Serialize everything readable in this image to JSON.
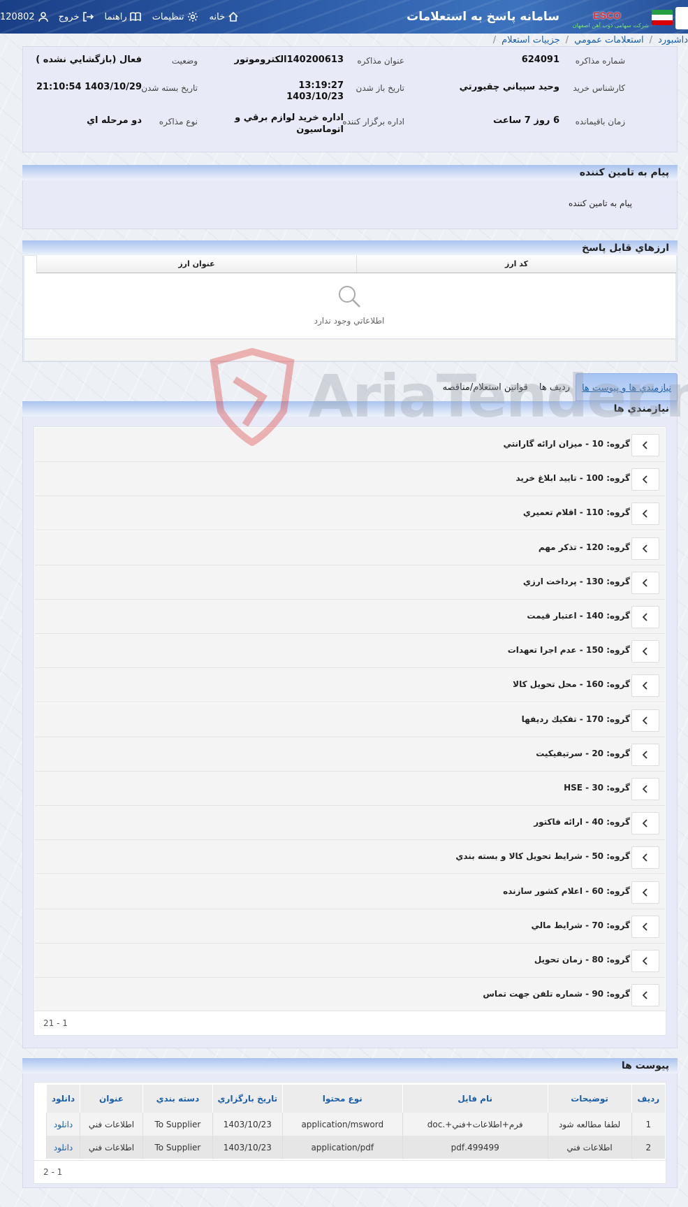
{
  "header": {
    "title": "سامانه پاسخ به استعلامات",
    "logo_text": "ESCO",
    "logo_subtitle": "شرکت سهامی ذوب آهن اصفهان",
    "user_id": "120802",
    "nav": [
      {
        "label": "خروج",
        "icon": "logout-icon"
      },
      {
        "label": "راهنما",
        "icon": "book-icon"
      },
      {
        "label": "تنظيمات",
        "icon": "gear-icon"
      },
      {
        "label": "خانه",
        "icon": "home-icon"
      }
    ]
  },
  "breadcrumb": [
    "داشبورد",
    "استعلامات عمومي",
    "جزييات استعلام"
  ],
  "info": {
    "negotiation_number_label": "شماره مذاکره",
    "negotiation_number": "624091",
    "title_label": "عنوان مذاکره",
    "title": "140200613الكتروموتور",
    "status_label": "وضعيت",
    "status": "فعال (بازگشايي نشده )",
    "buyer_label": "کارشناس خريد",
    "buyer": "وحيد سپياني چقيورتي",
    "open_date_label": "تاريخ باز شدن",
    "open_time": "13:19:27",
    "open_date": "1403/10/23",
    "close_date_label": "تاريخ بسته شدن",
    "close_date": "1403/10/29 21:10:54",
    "remaining_label": "زمان باقيمانده",
    "remaining": "6 روز 7 ساعت",
    "organizer_label": "اداره برگزار کننده",
    "organizer_line1": "اداره خريد لوازم برقي و",
    "organizer_line2": "اتوماسيون",
    "type_label": "نوع مذاکره",
    "type": "دو مرحله اي"
  },
  "supplier_message": {
    "heading": "پيام به تامين کننده",
    "body": "پيام به تامين کننده"
  },
  "currencies": {
    "heading": "ارزهاي قابل پاسخ",
    "col_code": "کد ارز",
    "col_title": "عنوان ارز",
    "empty_text": "اطلاعاتي وجود ندارد"
  },
  "tabs": [
    {
      "label": "نيازمندي ها و پيوست ها",
      "active": true
    },
    {
      "label": "رديف ها",
      "active": false
    },
    {
      "label": "قوانين استعلام/مناقصه",
      "active": false
    }
  ],
  "requirements": {
    "heading": "نيازمندي ها",
    "groups": [
      "گروه: 10 - ميزان ارائه گارانتي",
      "گروه: 100 - تاييد ابلاغ خريد",
      "گروه: 110 - اقلام تعميري",
      "گروه: 120 - تذکر مهم",
      "گروه: 130 - پرداخت ارزي",
      "گروه: 140 - اعتبار قيمت",
      "گروه: 150 - عدم اجرا تعهدات",
      "گروه: 160 - محل تحويل کالا",
      "گروه: 170 - تفکيك رديفها",
      "گروه: 20 - سرتيفيکيت",
      "گروه: 30 - HSE",
      "گروه: 40 - ارائه فاکتور",
      "گروه: 50 - شرايط تحويل کالا و بسته بندي",
      "گروه: 60 - اعلام کشور سازنده",
      "گروه: 70 - شرايط مالي",
      "گروه: 80 - زمان تحويل",
      "گروه: 90 - شماره تلفن جهت تماس"
    ],
    "pager": "21 - 1"
  },
  "attachments": {
    "heading": "پيوست ها",
    "columns": [
      "رديف",
      "توضيحات",
      "نام فايل",
      "نوع محتوا",
      "تاريخ بارگزاري",
      "دسته بندي",
      "عنوان",
      "دانلود"
    ],
    "rows": [
      [
        "1",
        "لطفا مطالعه شود",
        "فرم+اطلاعات+فني+.doc",
        "application/msword",
        "1403/10/23",
        "To Supplier",
        "اطلاعات فني",
        "دانلود"
      ],
      [
        "2",
        "اطلاعات فني",
        "499499.pdf",
        "application/pdf",
        "1403/10/23",
        "To Supplier",
        "اطلاعات فني",
        "دانلود"
      ]
    ],
    "pager": "2 - 1"
  },
  "watermark": "AriaTender.neT",
  "colors": {
    "header_bg": "#2b5aa6",
    "link": "#1a5fa8",
    "panel_bg": "#e8ebf7",
    "section_head": "#a9c3ef"
  }
}
